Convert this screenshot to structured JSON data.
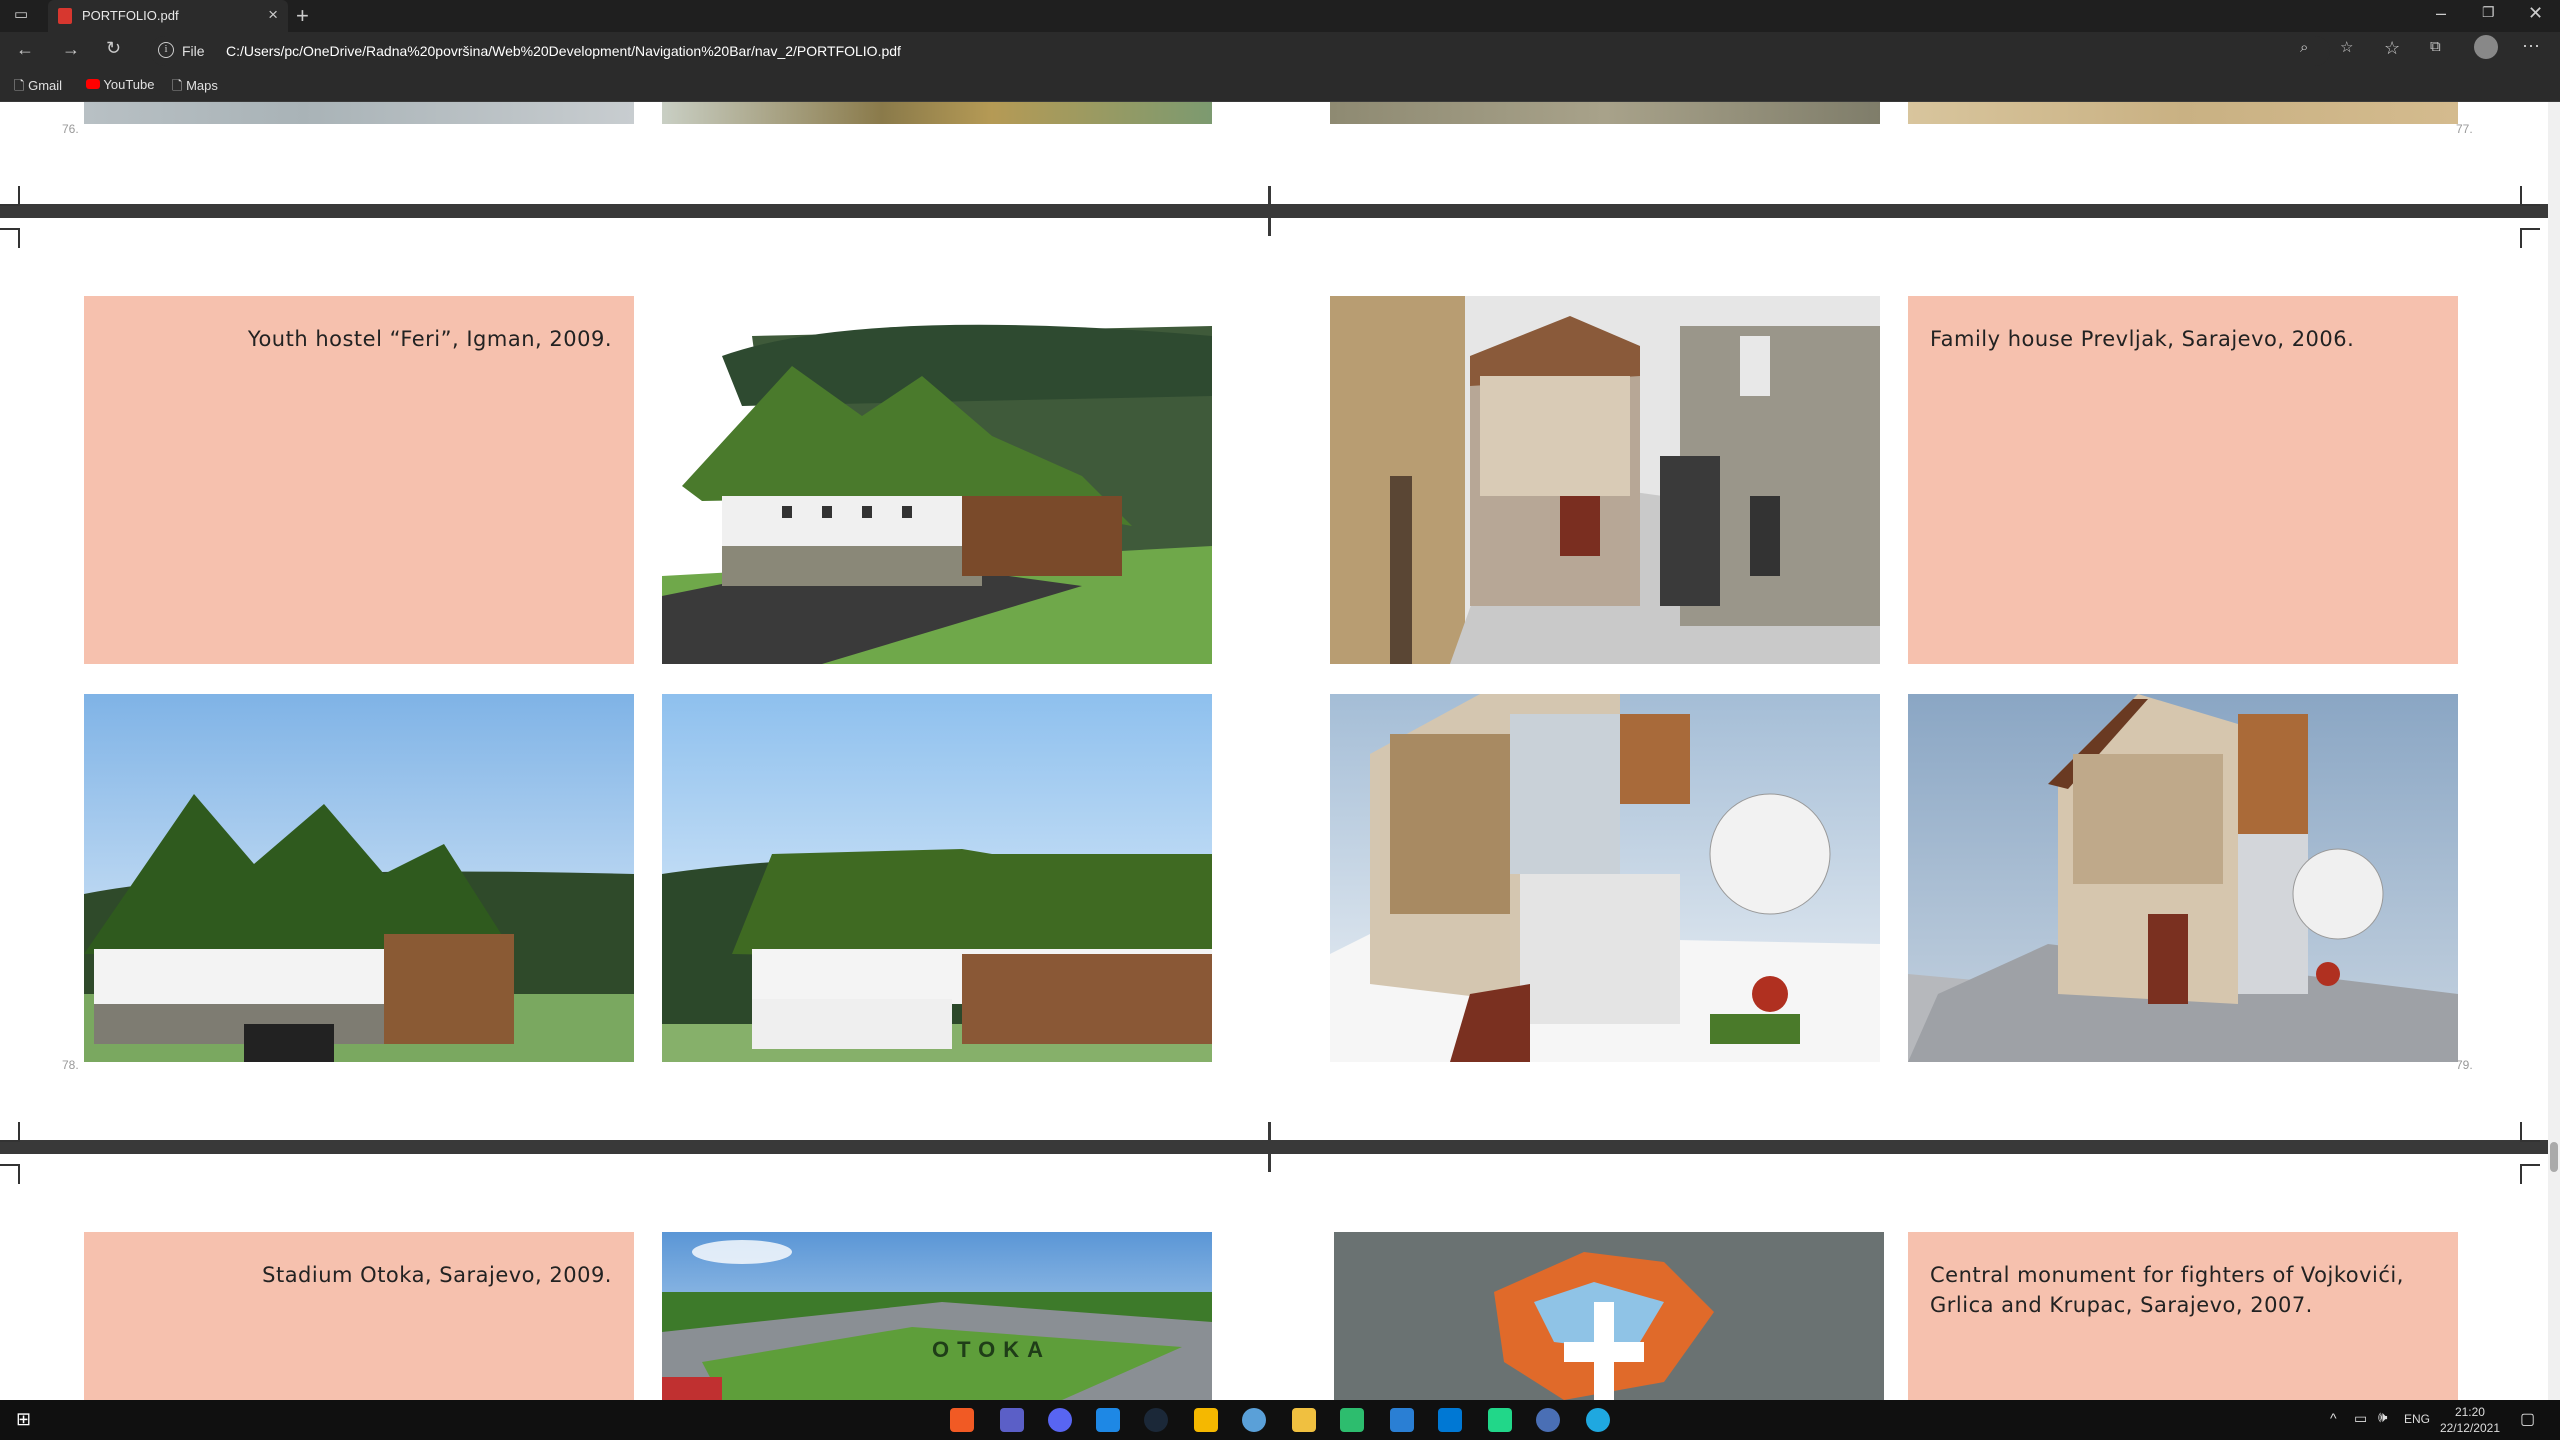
{
  "browser": {
    "tab_title": "PORTFOLIO.pdf",
    "file_label": "File",
    "url": "C:/Users/pc/OneDrive/Radna%20površina/Web%20Development/Navigation%20Bar/nav_2/PORTFOLIO.pdf",
    "bookmarks": [
      "Gmail",
      "YouTube",
      "Maps"
    ]
  },
  "pdf": {
    "page_numbers": {
      "p76": "76.",
      "p77": "77.",
      "p78": "78.",
      "p79": "79."
    },
    "captions": {
      "youth_hostel": "Youth hostel “Feri”, Igman, 2009.",
      "family_house": "Family house Prevljak, Sarajevo, 2006.",
      "stadium": "Stadium Otoka, Sarajevo, 2009.",
      "monument": "Central monument for fighters of Vojkovići, Grlica and Krupac, Sarajevo, 2007."
    },
    "image_labels": {
      "stadium_sign": "OTOKA"
    }
  },
  "taskbar": {
    "lang": "ENG",
    "time": "21:20",
    "date": "22/12/2021"
  },
  "colors": {
    "panel": "#f6c1ae",
    "separator": "#393939",
    "titlebar": "#1f1f1f"
  }
}
